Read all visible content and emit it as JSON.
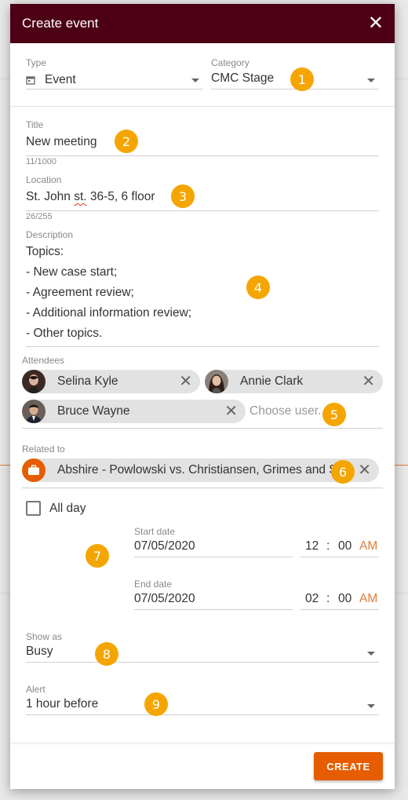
{
  "dialog": {
    "title": "Create event"
  },
  "type_field": {
    "label": "Type",
    "value": "Event"
  },
  "category_field": {
    "label": "Category",
    "value": "CMC Stage"
  },
  "title_field": {
    "label": "Title",
    "value": "New meeting",
    "counter": "11/1000"
  },
  "location_field": {
    "label": "Location",
    "value_before": "St. John ",
    "value_flagged": "st.",
    "value_after": " 36-5, 6 floor",
    "counter": "26/255"
  },
  "description_field": {
    "label": "Description",
    "lines": [
      "Topics:",
      "- New case start;",
      "- Agreement review;",
      "- Additional information review;",
      "- Other topics."
    ]
  },
  "attendees": {
    "label": "Attendees",
    "items": [
      {
        "name": "Selina Kyle"
      },
      {
        "name": "Annie Clark"
      },
      {
        "name": "Bruce Wayne"
      }
    ],
    "placeholder": "Choose user..."
  },
  "related": {
    "label": "Related to",
    "value": "Abshire - Powlowski vs. Christiansen, Grimes and Schmitt"
  },
  "all_day": {
    "label": "All day",
    "checked": false
  },
  "start": {
    "label": "Start date",
    "date": "07/05/2020",
    "hour": "12",
    "sep": ":",
    "minute": "00",
    "ampm": "AM"
  },
  "end": {
    "label": "End date",
    "date": "07/05/2020",
    "hour": "02",
    "sep": ":",
    "minute": "00",
    "ampm": "AM"
  },
  "show_as": {
    "label": "Show as",
    "value": "Busy"
  },
  "alert": {
    "label": "Alert",
    "value": "1 hour before"
  },
  "footer": {
    "create_label": "CREATE"
  },
  "badges": [
    "1",
    "2",
    "3",
    "4",
    "5",
    "6",
    "7",
    "8",
    "9"
  ],
  "colors": {
    "header": "#4d0015",
    "accent": "#e65c00",
    "badge": "#f5a500"
  }
}
